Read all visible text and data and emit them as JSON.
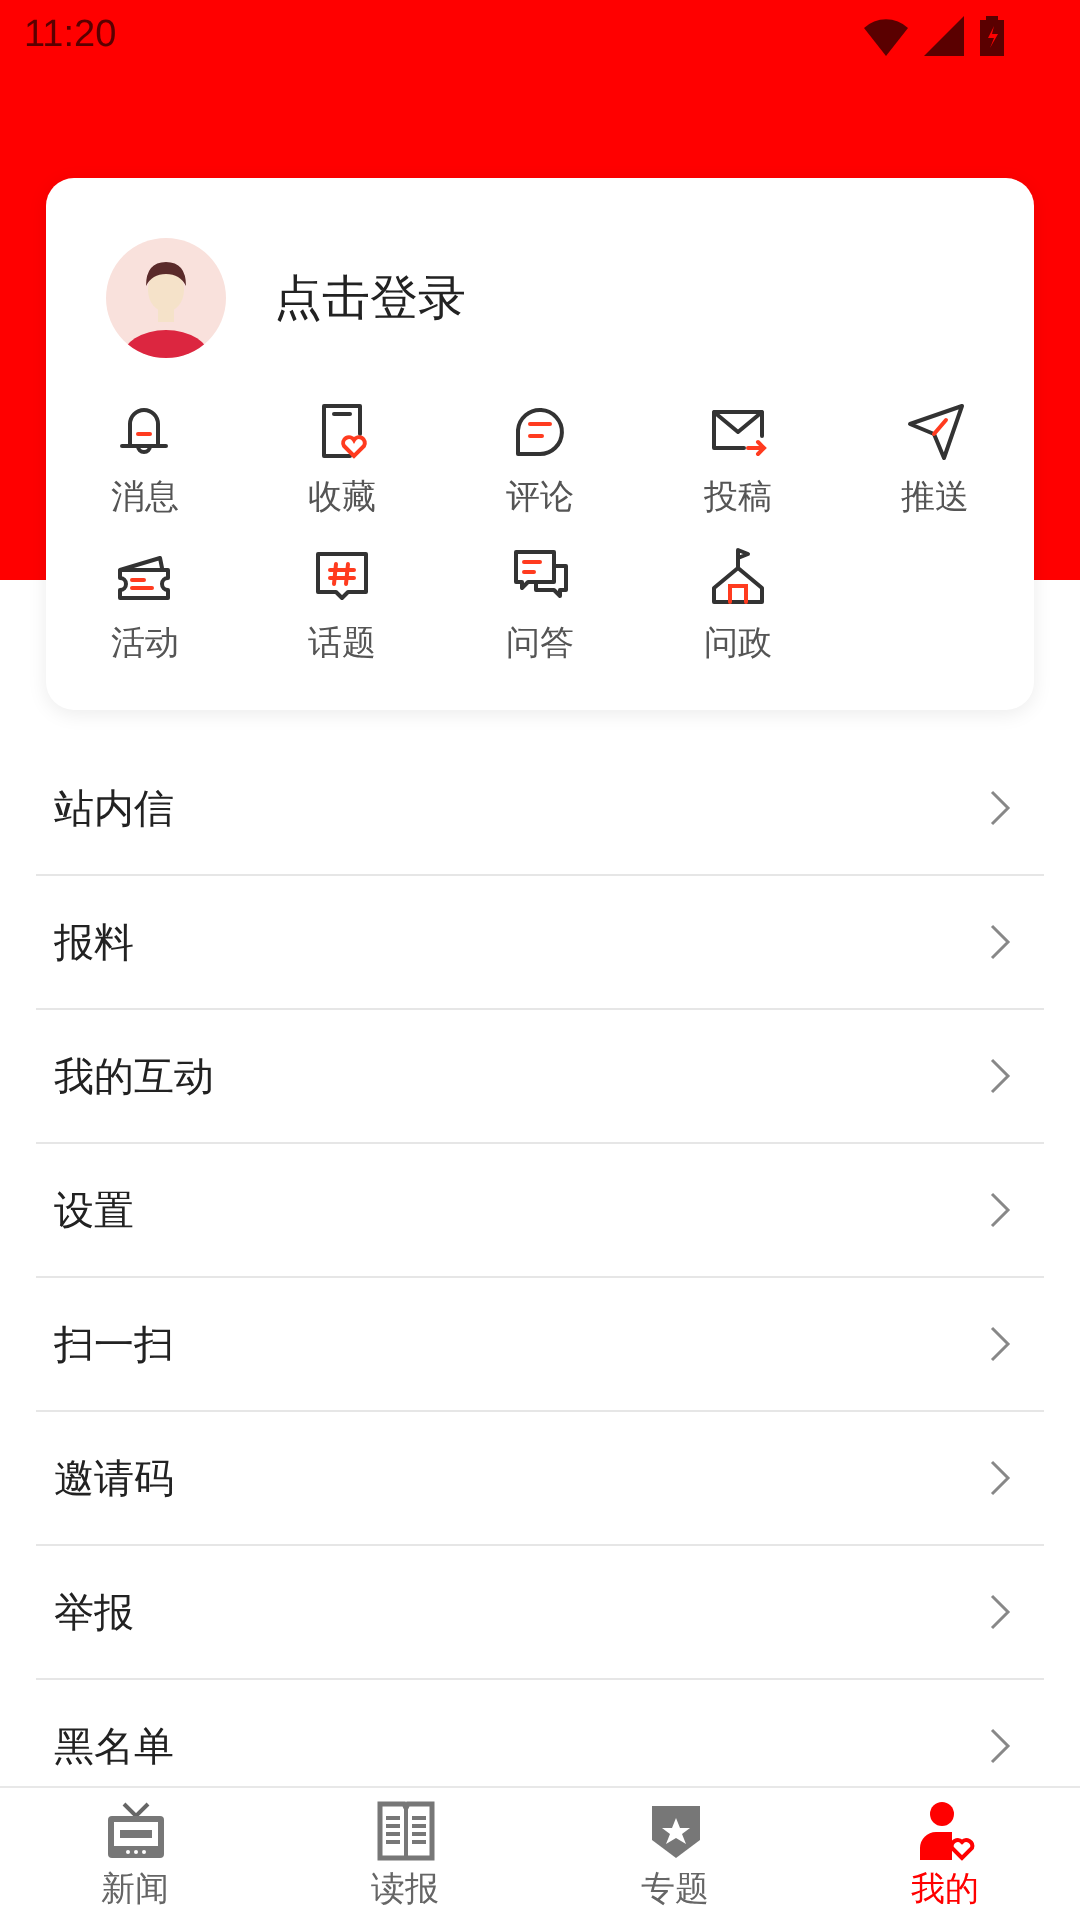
{
  "status_bar": {
    "time": "11:20"
  },
  "profile": {
    "login_text": "点击登录"
  },
  "shortcuts": [
    {
      "label": "消息"
    },
    {
      "label": "收藏"
    },
    {
      "label": "评论"
    },
    {
      "label": "投稿"
    },
    {
      "label": "推送"
    },
    {
      "label": "活动"
    },
    {
      "label": "话题"
    },
    {
      "label": "问答"
    },
    {
      "label": "问政"
    }
  ],
  "menu": [
    {
      "label": "站内信"
    },
    {
      "label": "报料"
    },
    {
      "label": "我的互动"
    },
    {
      "label": "设置"
    },
    {
      "label": "扫一扫"
    },
    {
      "label": "邀请码"
    },
    {
      "label": "举报"
    },
    {
      "label": "黑名单"
    }
  ],
  "tabs": [
    {
      "label": "新闻",
      "selected": false
    },
    {
      "label": "读报",
      "selected": false
    },
    {
      "label": "专题",
      "selected": false
    },
    {
      "label": "我的",
      "selected": true
    }
  ]
}
